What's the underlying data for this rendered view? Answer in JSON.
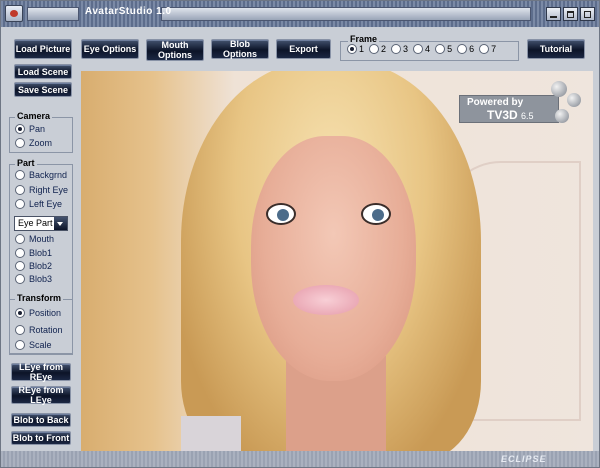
{
  "window": {
    "title": "AvatarStudio 1.0"
  },
  "toolbar": {
    "load_picture": "Load Picture",
    "eye_options": "Eye Options",
    "mouth_options": "Mouth Options",
    "blob_options": "Blob Options",
    "export": "Export",
    "tutorial": "Tutorial",
    "frame": {
      "title": "Frame",
      "options": [
        "1",
        "2",
        "3",
        "4",
        "5",
        "6",
        "7"
      ],
      "selected": "1"
    }
  },
  "sidebar": {
    "load_scene": "Load Scene",
    "save_scene": "Save Scene",
    "camera": {
      "title": "Camera",
      "options": [
        "Pan",
        "Zoom"
      ],
      "selected": "Pan"
    },
    "part": {
      "title": "Part",
      "options": [
        "Backgrnd",
        "Right Eye",
        "Left Eye"
      ],
      "dropdown_value": "Eye Part",
      "options2": [
        "Mouth",
        "Blob1",
        "Blob2",
        "Blob3"
      ]
    },
    "transform": {
      "title": "Transform",
      "options": [
        "Position",
        "Rotation",
        "Scale"
      ],
      "selected": "Position"
    },
    "leye_from_reye": "LEye from REye",
    "reye_from_leye": "REye from LEye",
    "blob_to_back": "Blob to Back",
    "blob_to_front": "Blob to Front"
  },
  "viewport": {
    "watermark": {
      "powered_by": "Powered by",
      "product": "TV3D",
      "version": "6.5"
    }
  },
  "footer": {
    "logo": "ECLIPSE"
  }
}
